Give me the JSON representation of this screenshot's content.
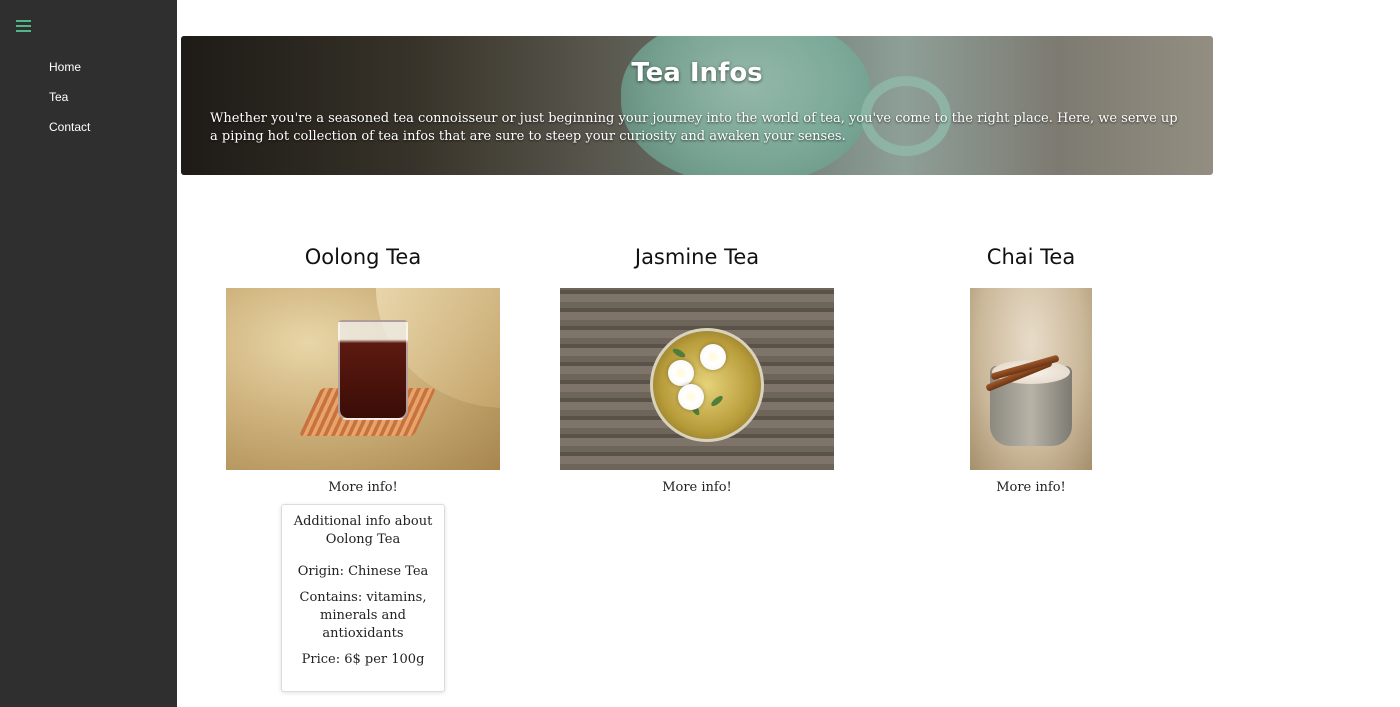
{
  "sidebar": {
    "menu_icon": "hamburger-icon",
    "items": [
      {
        "label": "Home"
      },
      {
        "label": "Tea"
      },
      {
        "label": "Contact"
      }
    ]
  },
  "hero": {
    "title": "Tea Infos",
    "text": "Whether you're a seasoned tea connoisseur or just beginning your journey into the world of tea, you've come to the right place. Here, we serve up a piping hot collection of tea infos that are sure to steep your curiosity and awaken your senses."
  },
  "teas": [
    {
      "name": "Oolong Tea",
      "more": "More info!"
    },
    {
      "name": "Jasmine Tea",
      "more": "More info!"
    },
    {
      "name": "Chai Tea",
      "more": "More info!"
    }
  ],
  "info": {
    "title": "Additional info about Oolong Tea",
    "origin": "Origin: Chinese Tea",
    "contains": "Contains: vitamins, minerals and antioxidants",
    "price": "Price: 6$ per 100g"
  },
  "colors": {
    "sidebar_bg": "#2f2f2f",
    "accent": "#52b788"
  }
}
